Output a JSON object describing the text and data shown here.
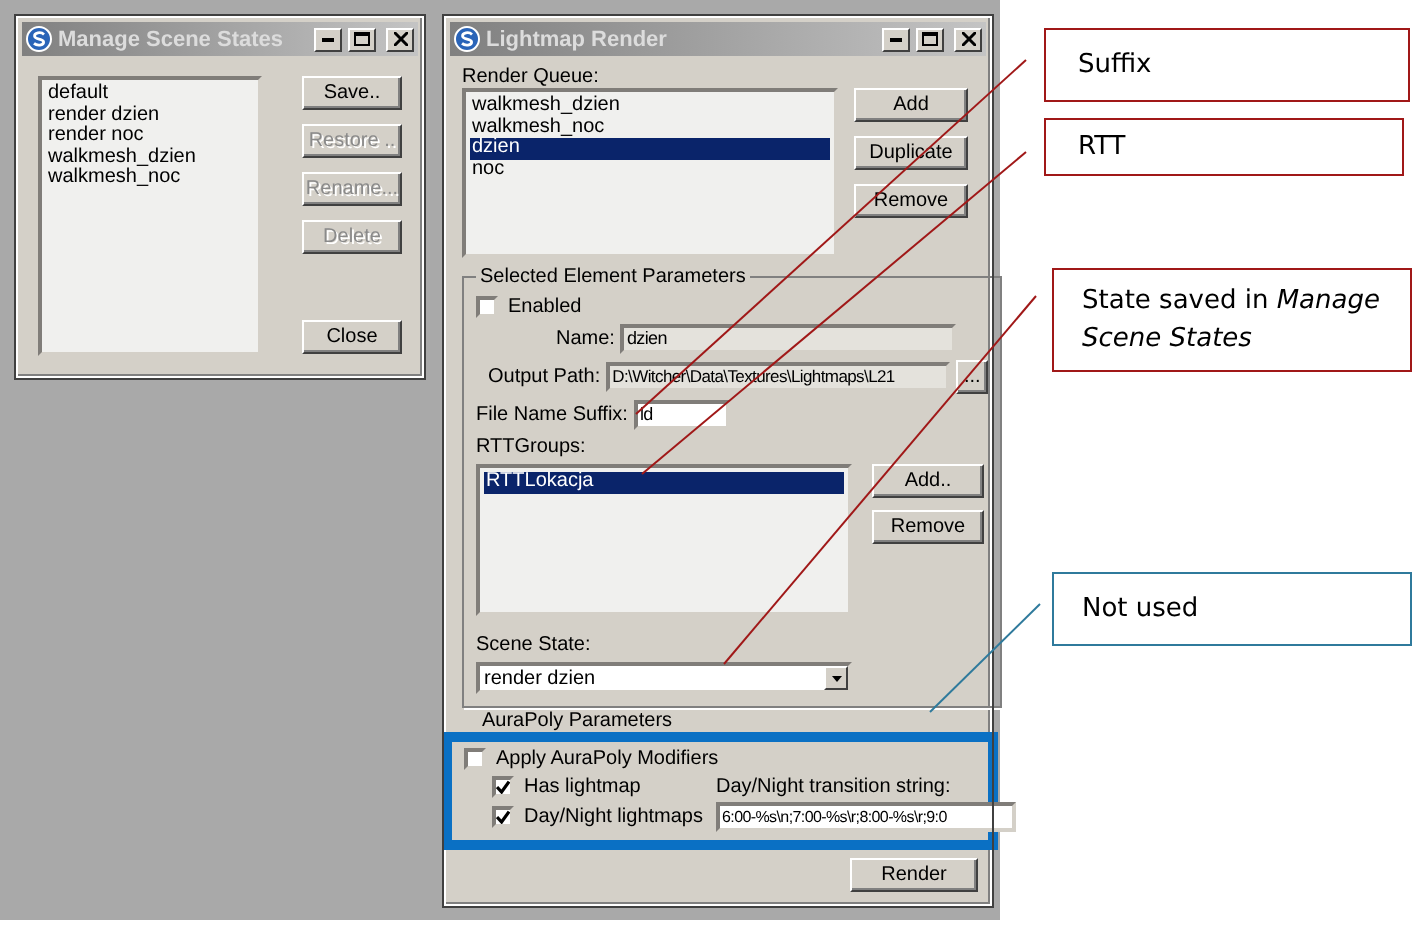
{
  "scene_states_window": {
    "title": "Manage Scene States",
    "states": [
      "default",
      "render dzien",
      "render noc",
      "walkmesh_dzien",
      "walkmesh_noc"
    ],
    "buttons": [
      {
        "label": "Save..",
        "disabled": false
      },
      {
        "label": "Restore ..",
        "disabled": true
      },
      {
        "label": "Rename...",
        "disabled": true
      },
      {
        "label": "Delete",
        "disabled": true
      },
      {
        "label": "Close",
        "disabled": false
      }
    ]
  },
  "lightmap_window": {
    "title": "Lightmap Render",
    "render_queue": {
      "label": "Render Queue:",
      "items": [
        {
          "label": "walkmesh_dzien",
          "selected": false
        },
        {
          "label": "walkmesh_noc",
          "selected": false
        },
        {
          "label": "dzien",
          "selected": true
        },
        {
          "label": "noc",
          "selected": false
        }
      ]
    },
    "queue_buttons": [
      "Add",
      "Duplicate",
      "Remove"
    ],
    "selected_element": {
      "title": "Selected Element Parameters",
      "enabled": {
        "label": "Enabled",
        "checked": false
      },
      "name": {
        "label": "Name:",
        "value": "dzien"
      },
      "output_path": {
        "label": "Output Path:",
        "value": "D:\\Witcher\\Data\\Textures\\Lightmaps\\L21",
        "browse": "..."
      },
      "suffix": {
        "label": "File Name Suffix:",
        "value": "ld"
      },
      "rtt_groups": {
        "label": "RTTGroups:",
        "items": [
          {
            "label": "RTTLokacja",
            "selected": true
          }
        ]
      },
      "rtt_buttons": [
        "Add..",
        "Remove"
      ],
      "scene_state": {
        "label": "Scene State:",
        "value": "render dzien"
      }
    },
    "aurapoly": {
      "title": "AuraPoly Parameters",
      "apply": {
        "label": "Apply AuraPoly Modifiers",
        "checked": false
      },
      "has_lightmap": {
        "label": "Has lightmap",
        "checked": true
      },
      "day_night": {
        "label": "Day/Night lightmaps",
        "checked": true
      },
      "transition": {
        "label": "Day/Night transition string:",
        "value": "6:00-%s\\n;7:00-%s\\r;8:00-%s\\r;9:0"
      }
    },
    "render_button": "Render"
  },
  "annotations": [
    {
      "text": "Suffix",
      "color": "#a01818"
    },
    {
      "text": "RTT",
      "color": "#a01818"
    },
    {
      "text": "State saved in *Manage Scene States*",
      "color": "#a01818"
    },
    {
      "text": "Not used",
      "color": "#2f7a9c"
    }
  ]
}
